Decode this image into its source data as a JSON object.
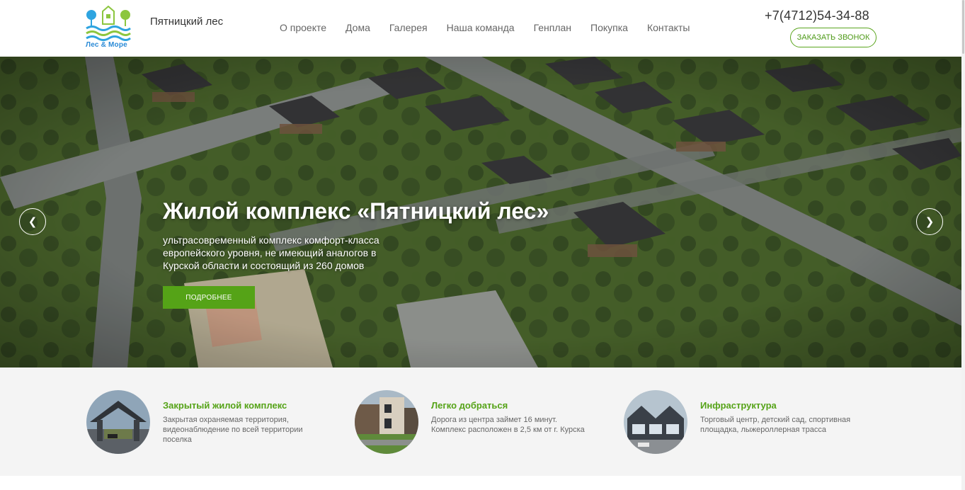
{
  "header": {
    "logo_text": "Лес & Море",
    "brand": "Пятницкий лес",
    "nav": [
      "О проекте",
      "Дома",
      "Галерея",
      "Наша команда",
      "Генплан",
      "Покупка",
      "Контакты"
    ],
    "phone": "+7(4712)54-34-88",
    "call_button": "ЗАКАЗАТЬ ЗВОНОК"
  },
  "hero": {
    "title": "Жилой комплекс «Пятницкий лес»",
    "description": "ультрасовременный комплекс комфорт-класса европейского уровня, не имеющий аналогов в Курской области и состоящий из 260 домов",
    "button": "ПОДРОБНЕЕ",
    "prev_icon": "chevron-left-icon",
    "next_icon": "chevron-right-icon"
  },
  "features": [
    {
      "title": "Закрытый жилой комплекс",
      "text": "Закрытая охраняемая территория, видеонаблюдение по всей территории поселка"
    },
    {
      "title": "Легко добраться",
      "text": "Дорога из центра займет 16 минут. Комплекс расположен в 2,5 км от г. Курска"
    },
    {
      "title": "Инфраструктура",
      "text": "Торговый центр, детский сад, спортивная площадка, лыжероллерная трасса"
    }
  ],
  "colors": {
    "accent_green": "#55a317",
    "logo_blue": "#2a8ad6"
  }
}
